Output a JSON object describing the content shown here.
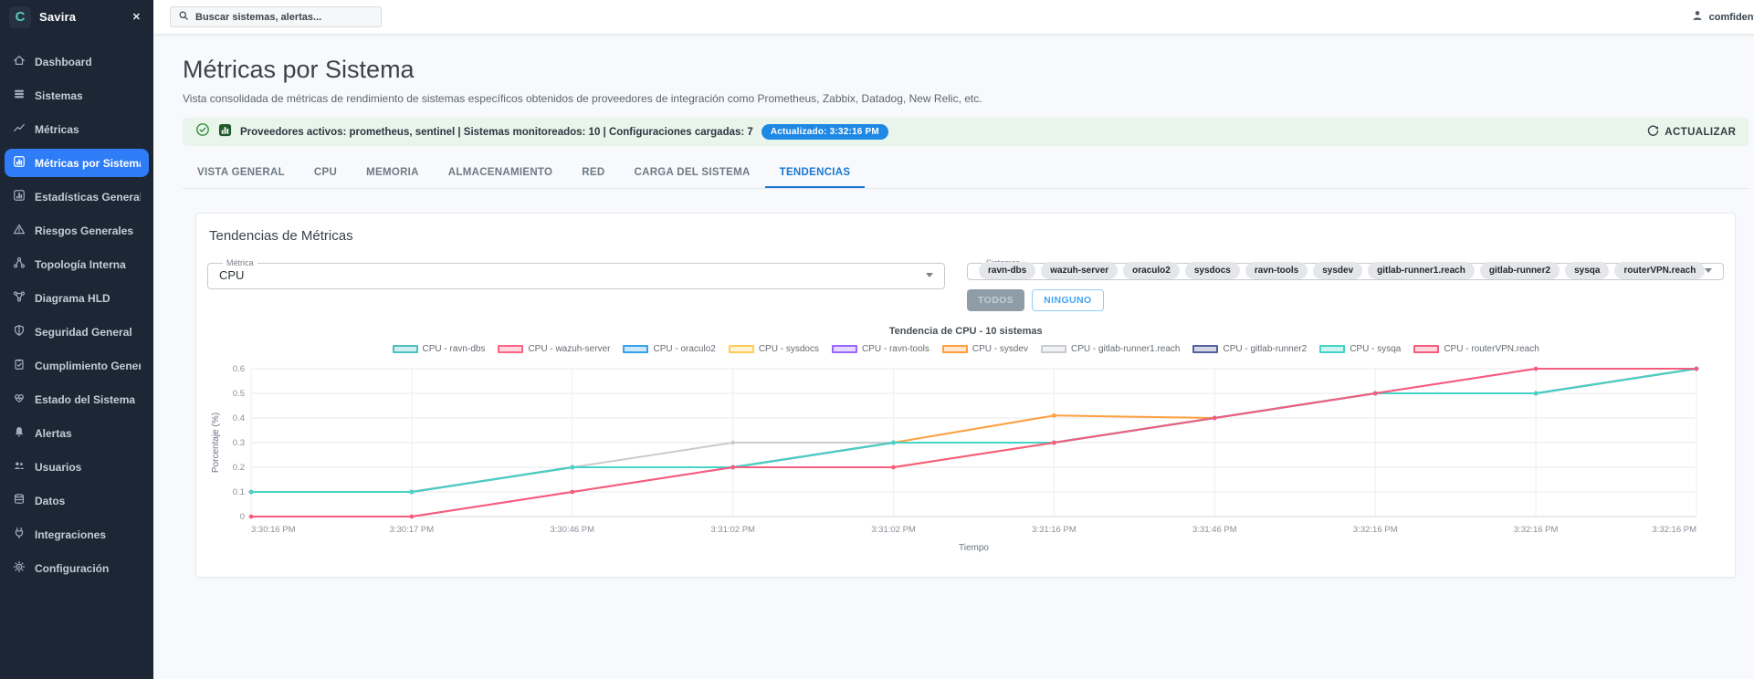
{
  "sidebar": {
    "brand": "Savira",
    "items": [
      {
        "label": "Dashboard"
      },
      {
        "label": "Sistemas"
      },
      {
        "label": "Métricas"
      },
      {
        "label": "Métricas por Sistema",
        "active": true
      },
      {
        "label": "Estadísticas Generales"
      },
      {
        "label": "Riesgos Generales"
      },
      {
        "label": "Topología Interna"
      },
      {
        "label": "Diagrama HLD"
      },
      {
        "label": "Seguridad General"
      },
      {
        "label": "Cumplimiento General"
      },
      {
        "label": "Estado del Sistema"
      },
      {
        "label": "Alertas"
      },
      {
        "label": "Usuarios"
      },
      {
        "label": "Datos"
      },
      {
        "label": "Integraciones"
      },
      {
        "label": "Configuración"
      }
    ]
  },
  "topbar": {
    "search_placeholder": "Buscar sistemas, alertas...",
    "user": "comfidentia"
  },
  "header": {
    "title": "Métricas por Sistema",
    "subtitle": "Vista consolidada de métricas de rendimiento de sistemas específicos obtenidos de proveedores de integración como Prometheus, Zabbix, Datadog, New Relic, etc."
  },
  "statusbar": {
    "text": "Proveedores activos: prometheus, sentinel | Sistemas monitoreados: 10 | Configuraciones cargadas: 7",
    "badge": "Actualizado: 3:32:16 PM",
    "refresh_label": "ACTUALIZAR"
  },
  "tabs": {
    "items": [
      "VISTA GENERAL",
      "CPU",
      "MEMORIA",
      "ALMACENAMIENTO",
      "RED",
      "CARGA DEL SISTEMA",
      "TENDENCIAS"
    ],
    "active": "TENDENCIAS"
  },
  "panel": {
    "title": "Tendencias de Métricas",
    "metric_label": "Métrica",
    "metric_value": "CPU",
    "systems_label": "Sistemas",
    "systems": [
      "ravn-dbs",
      "wazuh-server",
      "oraculo2",
      "sysdocs",
      "ravn-tools",
      "sysdev",
      "gitlab-runner1.reach",
      "gitlab-runner2",
      "sysqa",
      "routerVPN.reach"
    ],
    "all_button": "TODOS",
    "none_button": "NINGUNO"
  },
  "chart_data": {
    "type": "line",
    "title": "Tendencia de CPU - 10 sistemas",
    "xlabel": "Tiempo",
    "ylabel": "Porcentaje (%)",
    "ylim": [
      0,
      0.6
    ],
    "yticks": [
      0,
      0.1,
      0.2,
      0.3,
      0.4,
      0.5,
      0.6
    ],
    "grid": true,
    "legend_position": "top",
    "x": [
      "3:30:16 PM",
      "3:30:17 PM",
      "3:30:46 PM",
      "3:31:02 PM",
      "3:31:02 PM",
      "3:31:16 PM",
      "3:31:46 PM",
      "3:32:16 PM",
      "3:32:16 PM",
      "3:32:16 PM"
    ],
    "series": [
      {
        "name": "CPU - ravn-dbs",
        "color": "#4bc0c0",
        "values": [
          0.1,
          0.1,
          0.2,
          0.2,
          0.3,
          0.3,
          0.4,
          0.5,
          0.5,
          0.6
        ]
      },
      {
        "name": "CPU - wazuh-server",
        "color": "#ff6384",
        "values": [
          0,
          0,
          0.1,
          0.2,
          0.2,
          0.3,
          0.4,
          0.5,
          0.6,
          0.6
        ]
      },
      {
        "name": "CPU - oraculo2",
        "color": "#36a2eb",
        "values": [
          0.1,
          0.1,
          0.2,
          0.2,
          0.3,
          0.3,
          0.4,
          0.5,
          0.5,
          0.6
        ]
      },
      {
        "name": "CPU - sysdocs",
        "color": "#ffcd56",
        "values": [
          0.1,
          0.1,
          0.2,
          0.2,
          0.2,
          0.3,
          0.4,
          0.5,
          0.5,
          0.6
        ]
      },
      {
        "name": "CPU - ravn-tools",
        "color": "#9966ff",
        "values": [
          0.1,
          0.1,
          0.2,
          0.2,
          0.3,
          0.3,
          0.4,
          0.5,
          0.5,
          0.6
        ]
      },
      {
        "name": "CPU - sysdev",
        "color": "#ff9f40",
        "values": [
          0.1,
          0.1,
          0.2,
          0.2,
          0.3,
          0.41,
          0.4,
          0.5,
          0.5,
          0.6
        ]
      },
      {
        "name": "CPU - gitlab-runner1.reach",
        "color": "#c9cbcf",
        "values": [
          0.1,
          0.1,
          0.2,
          0.3,
          0.3,
          0.3,
          0.4,
          0.5,
          0.5,
          0.6
        ]
      },
      {
        "name": "CPU - gitlab-runner2",
        "color": "#52619b",
        "values": [
          0.1,
          0.1,
          0.2,
          0.2,
          0.3,
          0.3,
          0.4,
          0.5,
          0.5,
          0.6
        ]
      },
      {
        "name": "CPU - sysqa",
        "color": "#45d4c5",
        "values": [
          0.1,
          0.1,
          0.2,
          0.2,
          0.3,
          0.3,
          0.4,
          0.5,
          0.5,
          0.6
        ]
      },
      {
        "name": "CPU - routerVPN.reach",
        "color": "#f65c7d",
        "values": [
          0,
          0,
          0.1,
          0.2,
          0.2,
          0.3,
          0.4,
          0.5,
          0.6,
          0.6
        ]
      }
    ]
  },
  "colors": {
    "sidebar_bg": "#1c2634",
    "active_item": "#2e7cf6",
    "accent_blue": "#1976d2",
    "status_bg": "#e9f5eb",
    "badge_blue": "#1e88e5"
  }
}
